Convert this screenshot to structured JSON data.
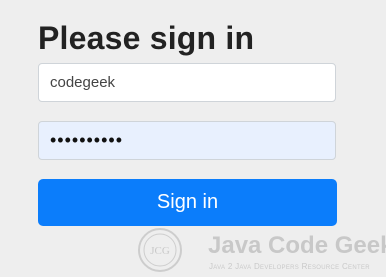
{
  "form": {
    "title": "Please sign in",
    "username_value": "codegeek",
    "password_value": "••••••••••",
    "submit_label": "Sign in"
  },
  "watermark": {
    "logo_text": "JCG",
    "brand": "Java Code Geeks",
    "tagline": "Java 2 Java Developers Resource Center"
  },
  "colors": {
    "background": "#eeeeee",
    "button": "#0b7dfb",
    "autofill": "#e8f0fe"
  }
}
